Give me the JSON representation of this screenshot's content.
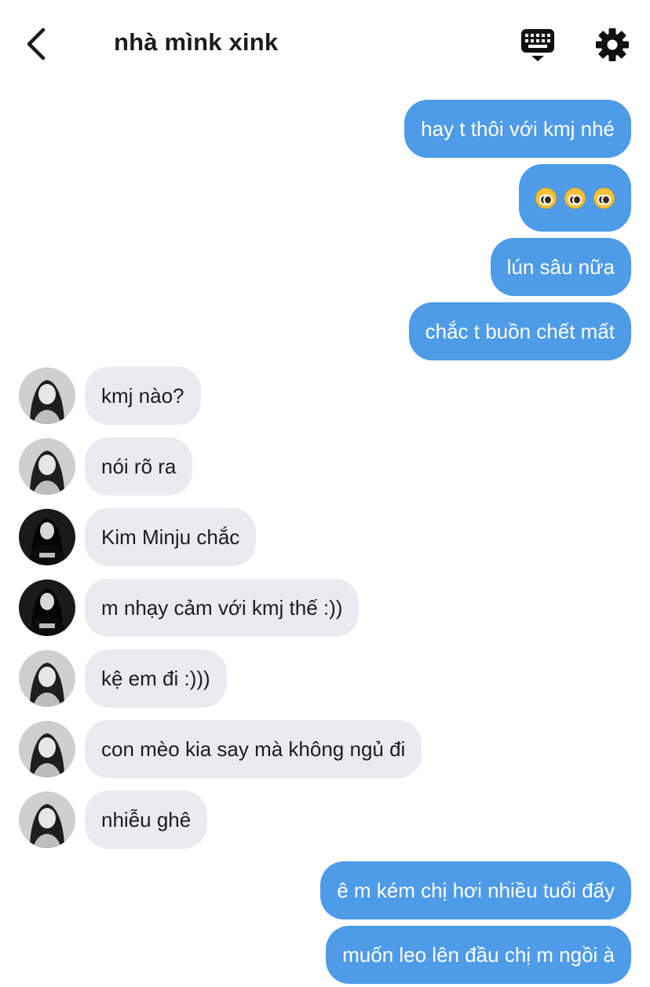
{
  "header": {
    "title": "nhà mìnk xink",
    "back_icon": "chevron-left-icon",
    "keyboard_icon": "keyboard-icon",
    "settings_icon": "gear-icon"
  },
  "colors": {
    "outgoing_bubble": "#4e9be8",
    "incoming_bubble": "#e9ebf0",
    "outgoing_text": "#ffffff",
    "incoming_text": "#1c1c1e"
  },
  "messages": [
    {
      "dir": "out",
      "text": "hay t thôi với kmj nhé"
    },
    {
      "dir": "out",
      "text": "🥺🥺🥺",
      "emoji": "pleading-face"
    },
    {
      "dir": "out",
      "text": "lún sâu nữa"
    },
    {
      "dir": "out",
      "text": "chắc t buồn chết mất"
    },
    {
      "dir": "in",
      "avatar": "portrait-girl-light",
      "text": "kmj nào?"
    },
    {
      "dir": "in",
      "avatar": "portrait-girl-light",
      "text": "nói rõ ra"
    },
    {
      "dir": "in",
      "avatar": "portrait-girl-dark",
      "text": "Kim Minju chắc"
    },
    {
      "dir": "in",
      "avatar": "portrait-girl-dark",
      "text": "m nhạy cảm với kmj thế :))"
    },
    {
      "dir": "in",
      "avatar": "portrait-girl-light",
      "text": "kệ em đi :)))"
    },
    {
      "dir": "in",
      "avatar": "portrait-girl-light",
      "text": "con mèo kia say mà không ngủ đi"
    },
    {
      "dir": "in",
      "avatar": "portrait-girl-light",
      "text": "nhiễu ghê"
    },
    {
      "dir": "out",
      "text": "ê m kém chị hơi nhiều tuổi đấy"
    },
    {
      "dir": "out",
      "text": "muốn leo lên đầu chị m ngồi à"
    }
  ]
}
